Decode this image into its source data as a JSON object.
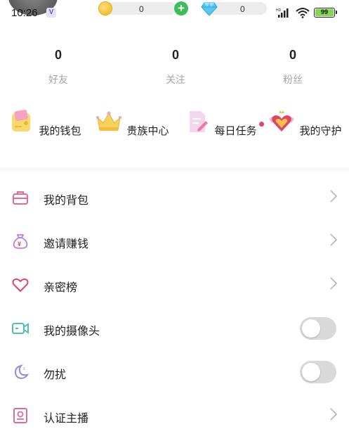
{
  "status_bar": {
    "time": "10:26",
    "app_badge": "V",
    "battery": "99",
    "battery_level": 0.99
  },
  "currency": {
    "coins": "0",
    "gems": "0"
  },
  "stats": [
    {
      "value": "0",
      "label": "好友"
    },
    {
      "value": "0",
      "label": "关注"
    },
    {
      "value": "0",
      "label": "粉丝"
    }
  ],
  "quick_entries": [
    {
      "label": "我的钱包",
      "icon": "wallet-icon"
    },
    {
      "label": "贵族中心",
      "icon": "crown-icon"
    },
    {
      "label": "每日任务",
      "icon": "task-icon",
      "has_dot": true
    },
    {
      "label": "我的守护",
      "icon": "guard-heart-icon"
    }
  ],
  "menu": [
    {
      "label": "我的背包",
      "icon": "backpack-icon",
      "control": "chevron"
    },
    {
      "label": "邀请赚钱",
      "icon": "money-bag-icon",
      "control": "chevron"
    },
    {
      "label": "亲密榜",
      "icon": "heart-icon",
      "control": "chevron"
    },
    {
      "label": "我的摄像头",
      "icon": "camera-icon",
      "control": "toggle",
      "on": false
    },
    {
      "label": "勿扰",
      "icon": "moon-icon",
      "control": "toggle",
      "on": false
    },
    {
      "label": "认证主播",
      "icon": "certified-icon",
      "control": "chevron"
    }
  ],
  "colors": {
    "accent_pink": "#e0456b",
    "label_gray": "#a5a5a5",
    "toggle_off": "#d9d9d9"
  }
}
